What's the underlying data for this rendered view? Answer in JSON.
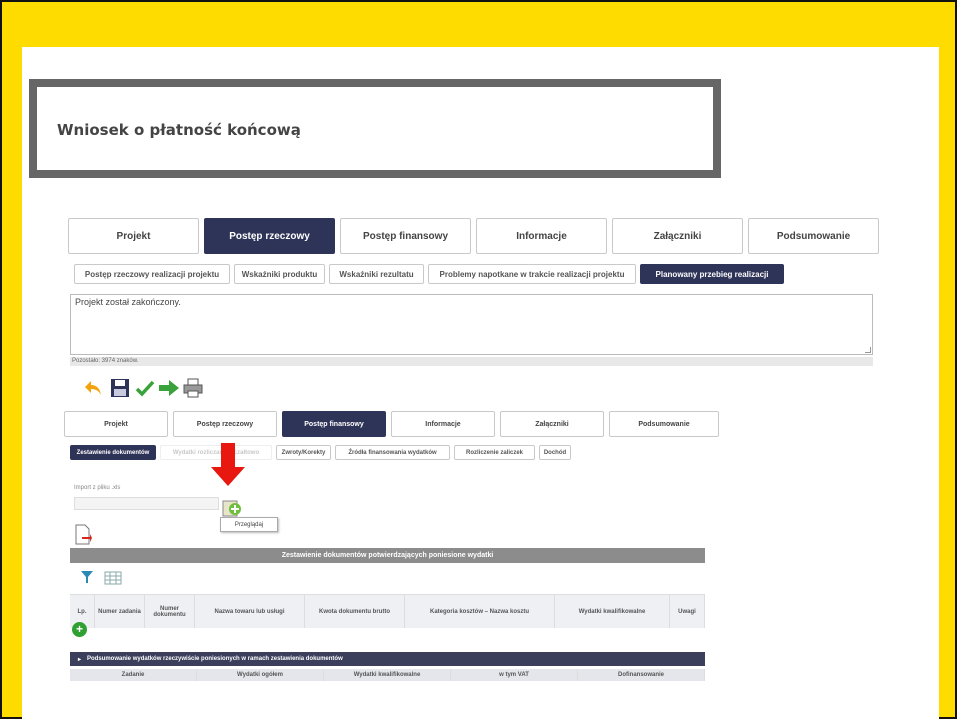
{
  "slide": {
    "title": "Wniosek o płatność końcową"
  },
  "main_tabs": [
    {
      "label": "Projekt"
    },
    {
      "label": "Postęp rzeczowy"
    },
    {
      "label": "Postęp finansowy"
    },
    {
      "label": "Informacje"
    },
    {
      "label": "Załączniki"
    },
    {
      "label": "Podsumowanie"
    }
  ],
  "sub_tabs": [
    {
      "label": "Postęp rzeczowy realizacji projektu"
    },
    {
      "label": "Wskaźniki produktu"
    },
    {
      "label": "Wskaźniki rezultatu"
    },
    {
      "label": "Problemy napotkane w trakcie realizacji projektu"
    },
    {
      "label": "Planowany przebieg realizacji"
    }
  ],
  "textarea": {
    "value": "Projekt został zakończony."
  },
  "char_count": "Pozostało: 3974 znaków.",
  "toolbar": {
    "icons": [
      "undo-icon",
      "save-icon",
      "check-icon",
      "forward-arrow-icon",
      "print-icon"
    ],
    "colors": {
      "undo": "#f2a20c",
      "save": "#2e3358",
      "check": "#3aa23a",
      "forward": "#3aa23a"
    }
  },
  "inner_tabs": [
    {
      "label": "Projekt"
    },
    {
      "label": "Postęp rzeczowy"
    },
    {
      "label": "Postęp finansowy"
    },
    {
      "label": "Informacje"
    },
    {
      "label": "Załączniki"
    },
    {
      "label": "Podsumowanie"
    }
  ],
  "inner_sub_tabs": [
    {
      "label": "Zestawienie dokumentów"
    },
    {
      "label": "Wydatki rozliczane ryczałtowo"
    },
    {
      "label": "Zwroty/Korekty"
    },
    {
      "label": "Źródła finansowania wydatków"
    },
    {
      "label": "Rozliczenie zaliczek"
    },
    {
      "label": "Dochód"
    }
  ],
  "upload": {
    "label": "Import z pliku .xls",
    "tooltip": "Przeglądaj"
  },
  "documents_section": {
    "header": "Zestawienie dokumentów potwierdzających poniesione wydatki",
    "columns": [
      "Lp.",
      "Numer zadania",
      "Numer dokumentu",
      "Nazwa towaru lub usługi",
      "Kwota dokumentu brutto",
      "Kategoria kosztów – Nazwa kosztu",
      "Wydatki kwalifikowalne",
      "Uwagi"
    ],
    "add_symbol": "+"
  },
  "summary_section": {
    "header": "Podsumowanie wydatków rzeczywiście poniesionych w ramach zestawienia dokumentów",
    "columns": [
      "Zadanie",
      "Wydatki ogółem",
      "Wydatki kwalifikowalne",
      "w tym VAT",
      "Dofinansowanie"
    ]
  },
  "colors": {
    "frame": "#ffdc00",
    "active_tab": "#2e3358",
    "red_arrow": "#e8170f"
  }
}
